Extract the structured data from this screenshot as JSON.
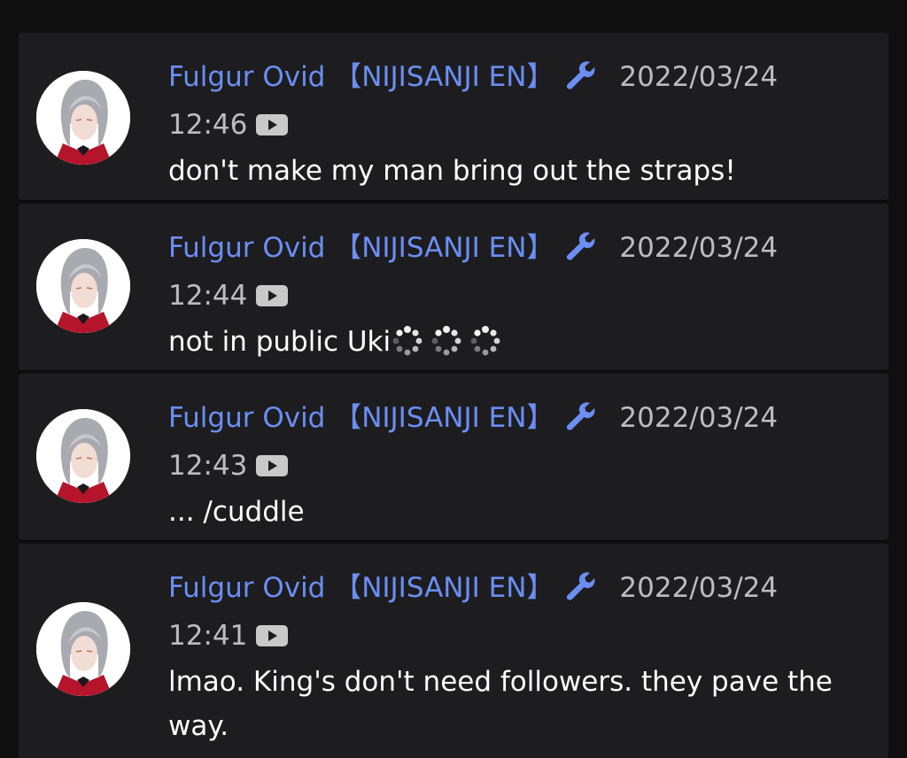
{
  "accent_color": "#6c8ef3",
  "author_icon": "wrench-icon",
  "timestamp_icon": "youtube-play-icon",
  "comments": [
    {
      "author": "Fulgur Ovid 【NIJISANJI EN】",
      "date": "2022/03/24",
      "time": "12:46",
      "message": "don't make my man bring out the straps!"
    },
    {
      "author": "Fulgur Ovid 【NIJISANJI EN】",
      "date": "2022/03/24",
      "time": "12:44",
      "message": "not in public Uki",
      "emoji_count": 3,
      "emoji_name": "loading-spinner-emoji"
    },
    {
      "author": "Fulgur Ovid 【NIJISANJI EN】",
      "date": "2022/03/24",
      "time": "12:43",
      "message": "... /cuddle"
    },
    {
      "author": "Fulgur Ovid 【NIJISANJI EN】",
      "date": "2022/03/24",
      "time": "12:41",
      "message": "lmao. King's don't need followers. they pave the way."
    }
  ]
}
